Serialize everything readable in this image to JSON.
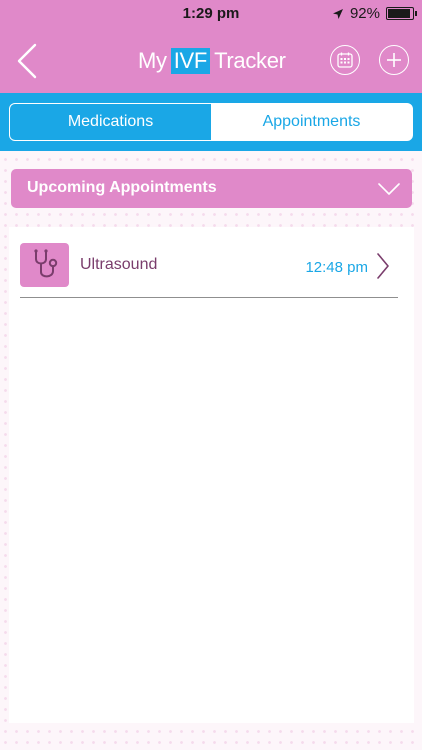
{
  "status_bar": {
    "time": "1:29 pm",
    "battery_percent": "92%",
    "battery_level": 0.92,
    "location_icon": "location-arrow-icon"
  },
  "nav": {
    "title_prefix": "My",
    "title_highlight": "IVF",
    "title_suffix": "Tracker",
    "back_icon": "chevron-left-icon",
    "calendar_icon": "calendar-icon",
    "add_icon": "plus-icon"
  },
  "tabs": [
    {
      "label": "Medications",
      "active": true
    },
    {
      "label": "Appointments",
      "active": false
    }
  ],
  "section": {
    "title": "Upcoming Appointments",
    "icon": "chevron-down-icon"
  },
  "appointments": [
    {
      "label": "Ultrasound",
      "time": "12:48 pm",
      "icon": "stethoscope-icon"
    }
  ],
  "colors": {
    "pink": "#e089c9",
    "blue": "#1aa7e6",
    "label_purple": "#7a3d6c"
  }
}
